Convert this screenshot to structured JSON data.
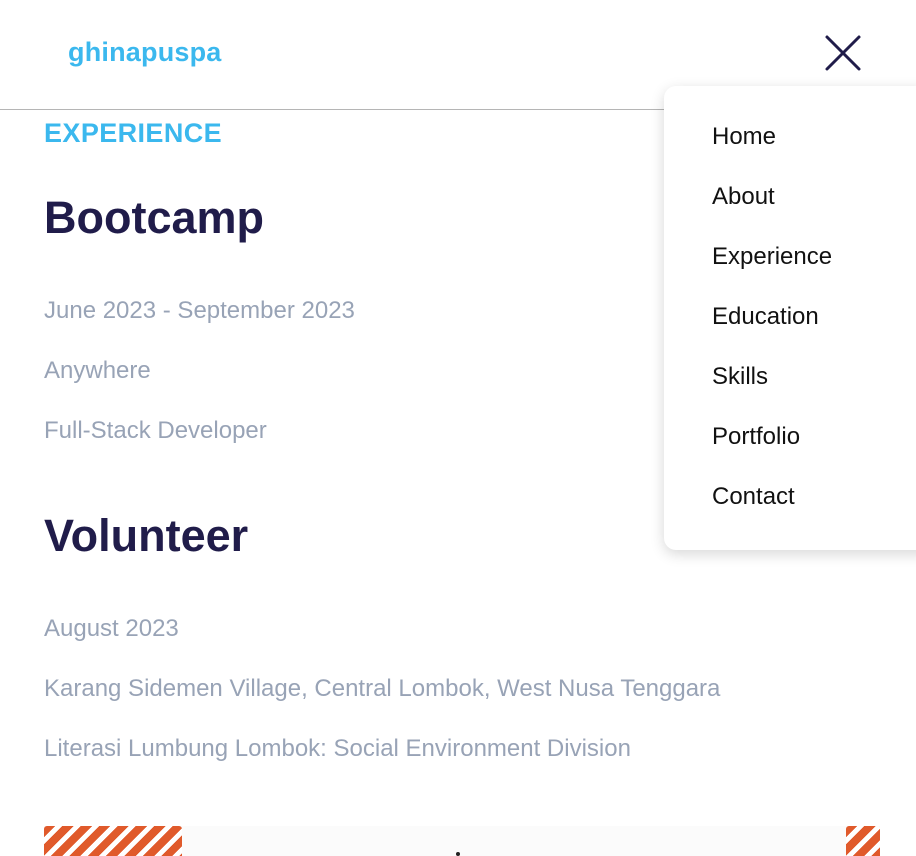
{
  "header": {
    "logo": "ghinapuspa"
  },
  "section": {
    "label": "EXPERIENCE"
  },
  "experiences": [
    {
      "title": "Bootcamp",
      "date": "June 2023 - September 2023",
      "location": "Anywhere",
      "role": "Full-Stack Developer"
    },
    {
      "title": "Volunteer",
      "date": "August 2023",
      "location": "Karang Sidemen Village, Central Lombok, West Nusa Tenggara",
      "role": "Literasi Lumbung Lombok: Social Environment Division"
    }
  ],
  "menu": {
    "items": [
      "Home",
      "About",
      "Experience",
      "Education",
      "Skills",
      "Portfolio",
      "Contact"
    ]
  },
  "icons": {
    "close": "close-icon"
  },
  "colors": {
    "accent": "#3bb8ee",
    "heading": "#201c4a",
    "muted": "#98a3b6",
    "stripe": "#e05a2b"
  }
}
